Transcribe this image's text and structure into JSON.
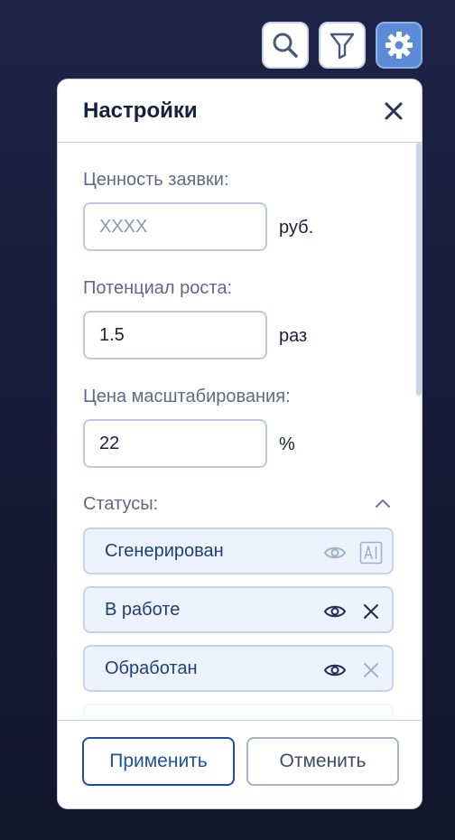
{
  "toolbar": {
    "search_icon": "search-icon",
    "filter_icon": "filter-icon",
    "settings_icon": "gear-icon",
    "active": "settings"
  },
  "panel": {
    "title": "Настройки",
    "close_icon": "close-icon"
  },
  "fields": {
    "value": {
      "label": "Ценность заявки:",
      "value": "",
      "placeholder": "XXXX",
      "unit": "руб."
    },
    "growth": {
      "label": "Потенциал роста:",
      "value": "1.5",
      "placeholder": "",
      "unit": "раз"
    },
    "scale": {
      "label": "Цена масштабирования:",
      "value": "22",
      "placeholder": "",
      "unit": "%"
    }
  },
  "statuses": {
    "label": "Статусы:",
    "expanded": true,
    "items": [
      {
        "label": "Сгенерирован",
        "visible_icon": "eye-icon",
        "action_icon": "ai-icon",
        "muted": true
      },
      {
        "label": "В работе",
        "visible_icon": "eye-icon",
        "action_icon": "close-icon",
        "muted": false
      },
      {
        "label": "Обработан",
        "visible_icon": "eye-icon",
        "action_icon": "close-icon",
        "muted": false
      }
    ]
  },
  "footer": {
    "apply_label": "Применить",
    "cancel_label": "Отменить"
  },
  "colors": {
    "background": "#1a1f3d",
    "accent": "#1d4fa0",
    "active_tool": "#5b8ad6",
    "status_fill": "#edf3fd"
  }
}
